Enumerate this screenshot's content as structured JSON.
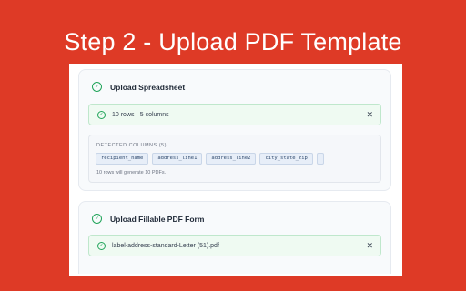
{
  "banner": {
    "title": "Step 2 - Upload PDF Template"
  },
  "spreadsheet": {
    "title": "Upload Spreadsheet",
    "status_text": "10 rows · 5 columns",
    "columns_label": "DETECTED COLUMNS (5)",
    "columns": [
      "recipient_name",
      "address_line1",
      "address_line2",
      "city_state_zip",
      ""
    ],
    "note": "10 rows will generate 10 PDFs."
  },
  "pdf_form": {
    "title": "Upload Fillable PDF Form",
    "file_name": "label-address-standard-Letter (51).pdf"
  },
  "icons": {
    "complete": "check-circle-icon",
    "remove": "close-icon"
  },
  "colors": {
    "background": "#de3a26",
    "success": "#22a55b",
    "chip_bg": "#e7eef8"
  }
}
